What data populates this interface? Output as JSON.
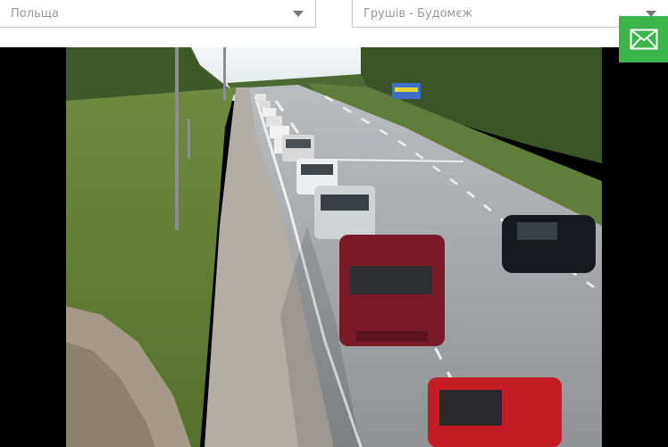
{
  "filters": {
    "country": {
      "value": "Польща"
    },
    "crossing": {
      "value": "Грушів - Будомєж"
    }
  },
  "actions": {
    "subscribe_icon": "envelope-icon",
    "accent_color": "#3bb54a"
  },
  "camera": {
    "alt": "Live camera view of queue at border crossing"
  }
}
